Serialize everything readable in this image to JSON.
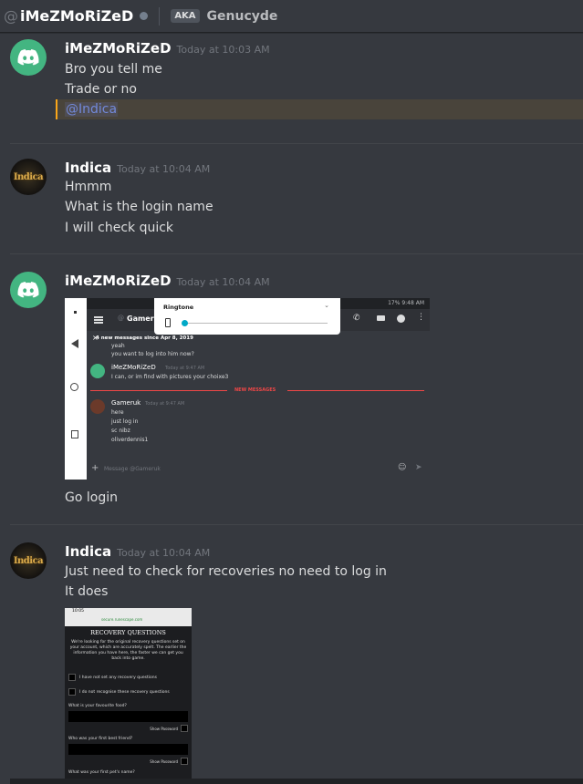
{
  "header": {
    "at": "@",
    "name": "iMeZMoRiZeD",
    "aka": "AKA",
    "nickname": "Genucyde"
  },
  "messages": [
    {
      "author": "iMeZMoRiZeD",
      "timestamp": "Today at 10:03 AM",
      "lines": [
        "Bro you tell me",
        "Trade or no"
      ],
      "mention": "@Indica"
    },
    {
      "author": "Indica",
      "timestamp": "Today at 10:04 AM",
      "lines": [
        "Hmmm",
        "What is the login name",
        "I will check quick"
      ]
    },
    {
      "author": "iMeZMoRiZeD",
      "timestamp": "Today at 10:04 AM",
      "after_image": "Go login"
    },
    {
      "author": "Indica",
      "timestamp": "Today at 10:04 AM",
      "lines": [
        "Just need to check for recoveries no need to log in",
        "It does"
      ]
    }
  ],
  "avatar_text": "Indica",
  "attachment1": {
    "statusbar": "17% 9:48 AM",
    "channel": "Gameruk",
    "ringtone_title": "Ringtone",
    "new_banner": "4 new messages since Apr 8, 2019",
    "line_yeah": "yeah",
    "line_want": "you want to log into him now?",
    "msg1_name": "iMeZMoRiZeD",
    "msg1_ts": "Today at 9:47 AM",
    "msg1_text": "I can, or im find with pictures your choixe3",
    "new_messages": "NEW MESSAGES",
    "msg2_name": "Gameruk",
    "msg2_ts": "Today at 9:47 AM",
    "msg2_lines": [
      "here",
      "just log in",
      "sc nibz",
      "oliverdennis1"
    ],
    "input_placeholder": "Message @Gameruk"
  },
  "attachment2": {
    "time": "10:05",
    "url": "secure.runescape.com",
    "title": "RECOVERY QUESTIONS",
    "intro": "We're looking for the original recovery questions set on your account, which are accurately spelt. The earlier the information you have here, the faster we can get you back into game.",
    "opt1": "I have not set any recovery questions",
    "opt2": "I do not recognise these recovery questions",
    "q1": "What is your favourite food?",
    "q2": "Who was your first best friend?",
    "q3": "What was your first pet's name?",
    "show_password": "Show Password"
  },
  "colors": {
    "background": "#36393f",
    "mention_highlight": "#faa61a",
    "discord_green": "#43b581",
    "new_messages_red": "#f04747"
  }
}
